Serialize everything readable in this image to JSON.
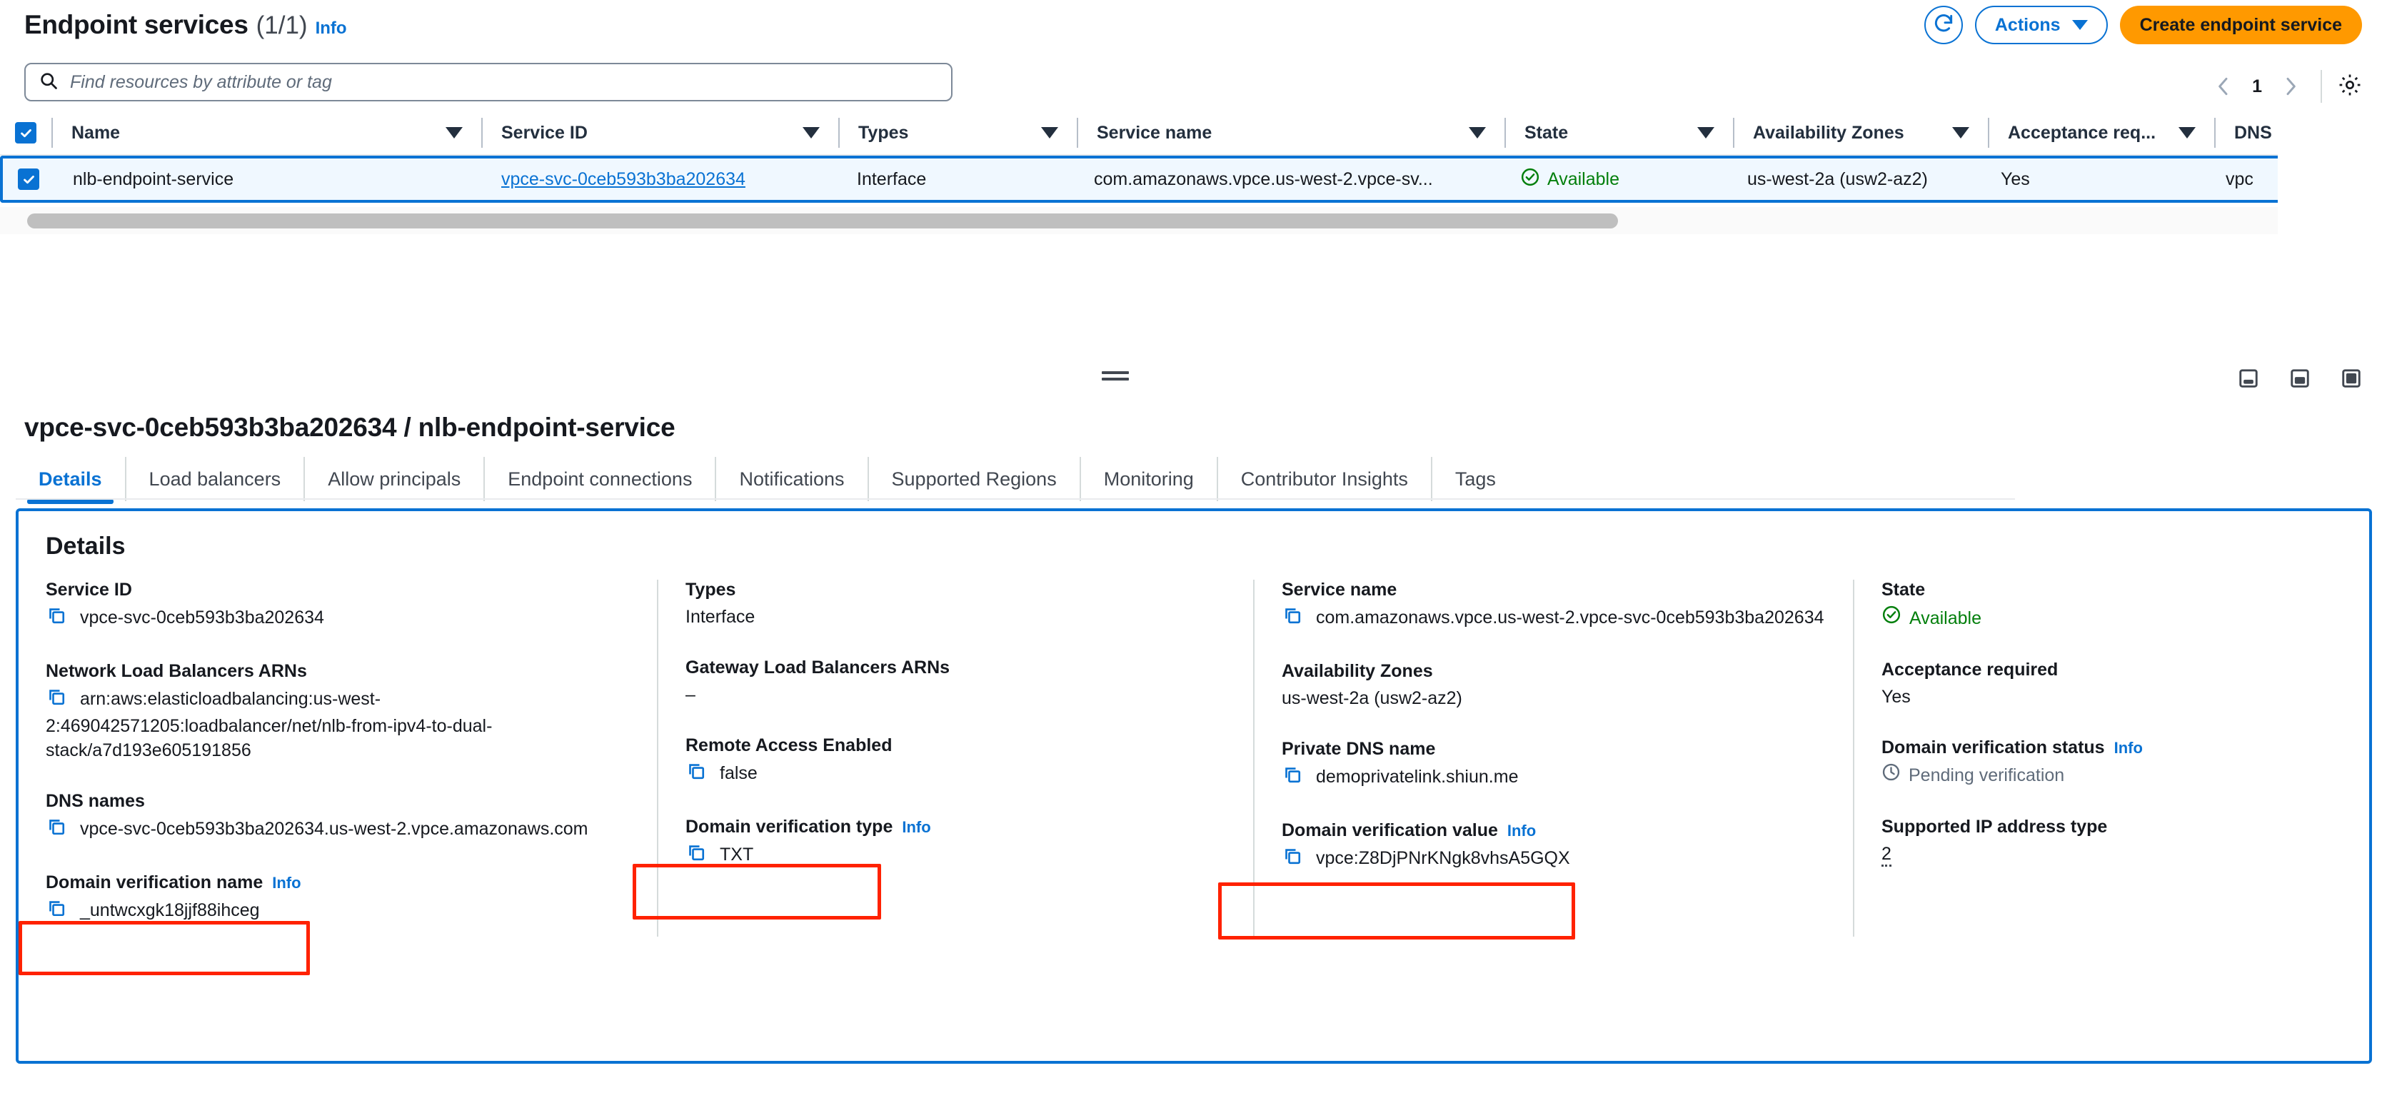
{
  "header": {
    "title": "Endpoint services",
    "count": "(1/1)",
    "info_label": "Info",
    "refresh_icon": "refresh-icon",
    "actions_label": "Actions",
    "create_label": "Create endpoint service"
  },
  "search": {
    "placeholder": "Find resources by attribute or tag",
    "icon": "search-icon"
  },
  "pagination": {
    "prev_icon": "chevron-left-icon",
    "page": "1",
    "next_icon": "chevron-right-icon",
    "settings_icon": "gear-icon"
  },
  "table": {
    "columns": [
      "Name",
      "Service ID",
      "Types",
      "Service name",
      "State",
      "Availability Zones",
      "Acceptance req...",
      "DNS"
    ],
    "rows": [
      {
        "selected": true,
        "name": "nlb-endpoint-service",
        "service_id": "vpce-svc-0ceb593b3ba202634",
        "types": "Interface",
        "service_name": "com.amazonaws.vpce.us-west-2.vpce-sv...",
        "state": "Available",
        "availability_zones": "us-west-2a (usw2-az2)",
        "acceptance_required": "Yes",
        "dns": "vpc"
      }
    ]
  },
  "split_panel": {
    "drag_handle": "drag-handle",
    "size_buttons": [
      "panel-dock-bottom-icon",
      "panel-dock-side-icon",
      "panel-maximize-icon"
    ],
    "title": "vpce-svc-0ceb593b3ba202634 / nlb-endpoint-service",
    "tabs": [
      {
        "label": "Details",
        "active": true
      },
      {
        "label": "Load balancers",
        "active": false
      },
      {
        "label": "Allow principals",
        "active": false
      },
      {
        "label": "Endpoint connections",
        "active": false
      },
      {
        "label": "Notifications",
        "active": false
      },
      {
        "label": "Supported Regions",
        "active": false
      },
      {
        "label": "Monitoring",
        "active": false
      },
      {
        "label": "Contributor Insights",
        "active": false
      },
      {
        "label": "Tags",
        "active": false
      }
    ]
  },
  "details": {
    "heading": "Details",
    "info_label": "Info",
    "col1": {
      "service_id_label": "Service ID",
      "service_id_value": "vpce-svc-0ceb593b3ba202634",
      "nlb_arns_label": "Network Load Balancers ARNs",
      "nlb_arns_value": "arn:aws:elasticloadbalancing:us-west-2:469042571205:loadbalancer/net/nlb-from-ipv4-to-dual-stack/a7d193e605191856",
      "dns_names_label": "DNS names",
      "dns_names_value": "vpce-svc-0ceb593b3ba202634.us-west-2.vpce.amazonaws.com",
      "domain_verification_name_label": "Domain verification name",
      "domain_verification_name_value": "_untwcxgk18jjf88ihceg"
    },
    "col2": {
      "types_label": "Types",
      "types_value": "Interface",
      "gwlb_arns_label": "Gateway Load Balancers ARNs",
      "gwlb_arns_value": "–",
      "remote_access_label": "Remote Access Enabled",
      "remote_access_value": "false",
      "domain_verification_type_label": "Domain verification type",
      "domain_verification_type_value": "TXT"
    },
    "col3": {
      "service_name_label": "Service name",
      "service_name_value": "com.amazonaws.vpce.us-west-2.vpce-svc-0ceb593b3ba202634",
      "availability_zones_label": "Availability Zones",
      "availability_zones_value": "us-west-2a (usw2-az2)",
      "private_dns_name_label": "Private DNS name",
      "private_dns_name_value": "demoprivatelink.shiun.me",
      "domain_verification_value_label": "Domain verification value",
      "domain_verification_value_value": "vpce:Z8DjPNrKNgk8vhsA5GQX"
    },
    "col4": {
      "state_label": "State",
      "state_value": "Available",
      "acceptance_required_label": "Acceptance required",
      "acceptance_required_value": "Yes",
      "domain_verification_status_label": "Domain verification status",
      "domain_verification_status_value": "Pending verification",
      "supported_ip_label": "Supported IP address type",
      "supported_ip_value": "2"
    }
  },
  "colors": {
    "accent_blue": "#0972d3",
    "create_orange": "#ff9900",
    "success_green": "#037f0c",
    "pending_gray": "#5f6b7a",
    "annotation_red": "#ff2200"
  }
}
